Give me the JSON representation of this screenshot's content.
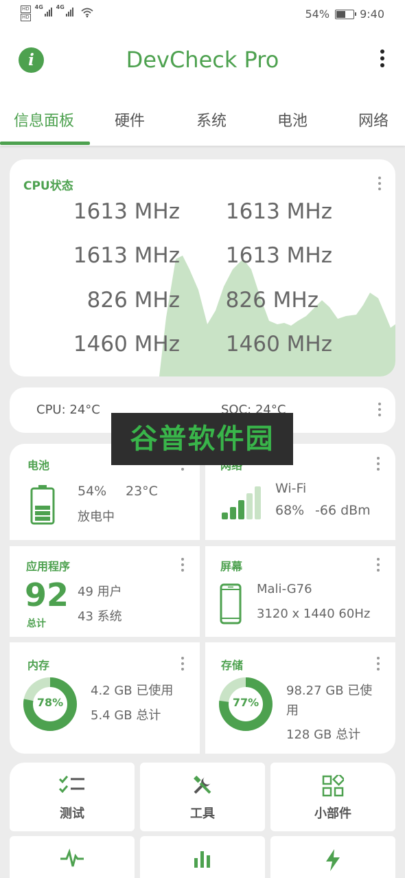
{
  "status_bar": {
    "battery_percent": "54%",
    "battery_level": 0.54,
    "time": "9:40",
    "network_type_1": "4G",
    "network_type_2": "4G",
    "hd_1": "HD",
    "hd_2": "HD"
  },
  "app_bar": {
    "title": "DevCheck Pro",
    "info_icon": "info-icon",
    "info_glyph": "i",
    "overflow_icon": "more-vert-icon"
  },
  "tabs": [
    {
      "label": "信息面板",
      "active": true
    },
    {
      "label": "硬件",
      "active": false
    },
    {
      "label": "系统",
      "active": false
    },
    {
      "label": "电池",
      "active": false
    },
    {
      "label": "网络",
      "active": false
    }
  ],
  "cpu_card": {
    "title": "CPU状态",
    "frequencies": [
      "1613 MHz",
      "1613 MHz",
      "1613 MHz",
      "1613 MHz",
      "826 MHz",
      "826 MHz",
      "1460 MHz",
      "1460 MHz"
    ]
  },
  "temperature_card": {
    "cpu": "CPU: 24°C",
    "soc": "SOC: 24°C"
  },
  "battery_card": {
    "title": "电池",
    "percent": "54%",
    "temperature": "23°C",
    "status": "放电中",
    "level": 0.54
  },
  "network_card": {
    "title": "网络",
    "type": "Wi-Fi",
    "strength": "68%",
    "signal": "-66 dBm",
    "signal_bars_active": 3,
    "signal_bars_total": 5
  },
  "apps_card": {
    "title": "应用程序",
    "total": "92",
    "total_label": "总计",
    "user": "49 用户",
    "system": "43 系统"
  },
  "screen_card": {
    "title": "屏幕",
    "gpu": "Mali-G76",
    "resolution": "3120 x 1440  60Hz"
  },
  "memory_card": {
    "title": "内存",
    "percent_label": "78%",
    "percent": 78,
    "used": "4.2 GB 已使用",
    "total": "5.4 GB 总计"
  },
  "storage_card": {
    "title": "存储",
    "percent_label": "77%",
    "percent": 77,
    "used_line1": "98.27 GB 已使",
    "used_line2": "用",
    "total": "128 GB 总计"
  },
  "tools": [
    {
      "label": "测试",
      "icon": "checklist-icon"
    },
    {
      "label": "工具",
      "icon": "tools-icon"
    },
    {
      "label": "小部件",
      "icon": "widgets-icon"
    },
    {
      "label": "",
      "icon": "pulse-icon"
    },
    {
      "label": "",
      "icon": "bar-chart-icon"
    },
    {
      "label": "",
      "icon": "bolt-icon"
    }
  ],
  "watermark": {
    "text": "谷普软件园"
  },
  "colors": {
    "accent": "#4da14f",
    "graph_fill": "#c9e3c6",
    "background": "#ececec",
    "card": "#ffffff"
  }
}
